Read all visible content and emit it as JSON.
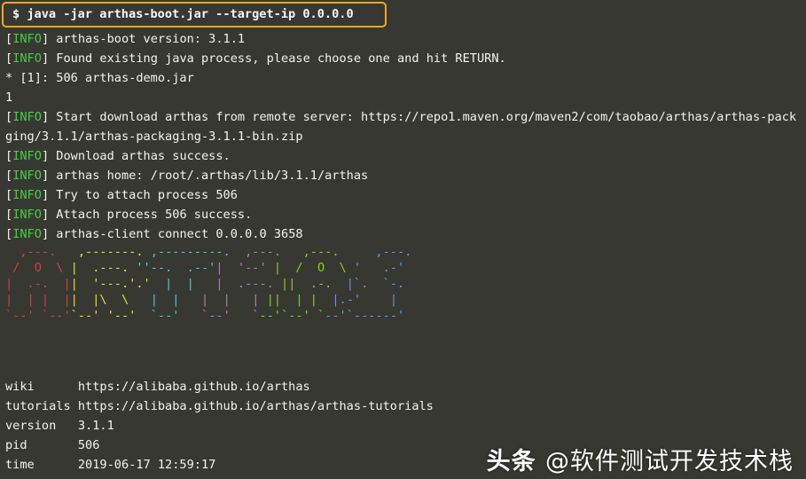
{
  "terminal": {
    "background_color": "#383833",
    "foreground_color": "#f2f2f0",
    "prompt_box_color": "#f5a71b",
    "info_tag_color": "#41d13c"
  },
  "command": {
    "prompt": "$",
    "text": "$ java -jar arthas-boot.jar --target-ip 0.0.0.0"
  },
  "log_lines": [
    {
      "tag": "[INFO]",
      "text": " arthas-boot version: 3.1.1"
    },
    {
      "tag": "[INFO]",
      "text": " Found existing java process, please choose one and hit RETURN."
    }
  ],
  "process_line": "* [1]: 506 arthas-demo.jar",
  "selection_input": "1",
  "download_lines": [
    {
      "tag": "[INFO]",
      "text": " Start download arthas from remote server: https://repo1.maven.org/maven2/com/taobao/arthas/arthas-pack"
    },
    {
      "tag": "",
      "text": "ging/3.1.1/arthas-packaging-3.1.1-bin.zip"
    },
    {
      "tag": "[INFO]",
      "text": " Download arthas success."
    },
    {
      "tag": "[INFO]",
      "text": " arthas home: /root/.arthas/lib/3.1.1/arthas"
    },
    {
      "tag": "[INFO]",
      "text": " Try to attach process 506"
    },
    {
      "tag": "[INFO]",
      "text": " Attach process 506 success."
    },
    {
      "tag": "[INFO]",
      "text": " arthas-client connect 0.0.0.0 3658"
    }
  ],
  "banner": {
    "description": "ARTHAS ascii-art logo in rainbow colors",
    "colors": [
      "#d43f3a",
      "#e8e030",
      "#3ad1d1",
      "#b07cb8",
      "#7ed321",
      "#5b9bd5"
    ],
    "rows": [
      [
        {
          "color": "c-red",
          "text": "  ,---.  "
        },
        {
          "color": "c-yellow",
          "text": " ,-------. "
        },
        {
          "color": "c-cyan",
          "text": ",---------. "
        },
        {
          "color": "c-purple",
          "text": " ,---.  "
        },
        {
          "color": "c-green",
          "text": " ,---.    "
        },
        {
          "color": "c-blue",
          "text": " ,---. "
        }
      ],
      [
        {
          "color": "c-red",
          "text": " /  O  \\ "
        },
        {
          "color": "c-yellow",
          "text": "|  .---. "
        },
        {
          "color": "c-cyan",
          "text": "''--.  .--'"
        },
        {
          "color": "c-purple",
          "text": "|  '--' "
        },
        {
          "color": "c-green",
          "text": "|  /  O  \\ "
        },
        {
          "color": "c-blue",
          "text": "'   .-'"
        }
      ],
      [
        {
          "color": "c-red",
          "text": "|  .-.  |"
        },
        {
          "color": "c-yellow",
          "text": "|  '---.'.'"
        },
        {
          "color": "c-cyan",
          "text": "  |  |   "
        },
        {
          "color": "c-purple",
          "text": "|  .---. "
        },
        {
          "color": "c-green",
          "text": "||  .-.  "
        },
        {
          "color": "c-blue",
          "text": "|`.  `-. "
        }
      ],
      [
        {
          "color": "c-red",
          "text": "|  | |  |"
        },
        {
          "color": "c-yellow",
          "text": "|  |\\  \\ "
        },
        {
          "color": "c-cyan",
          "text": "  |  |   "
        },
        {
          "color": "c-purple",
          "text": "|  |   | "
        },
        {
          "color": "c-green",
          "text": "||  | |  "
        },
        {
          "color": "c-blue",
          "text": "|.-'    |"
        }
      ],
      [
        {
          "color": "c-red",
          "text": "`--' `--'"
        },
        {
          "color": "c-yellow",
          "text": "`--' '--'"
        },
        {
          "color": "c-cyan",
          "text": "  `--'   "
        },
        {
          "color": "c-purple",
          "text": "`--'   `"
        },
        {
          "color": "c-green",
          "text": "--'`--' `"
        },
        {
          "color": "c-blue",
          "text": "--'`------'"
        }
      ]
    ]
  },
  "info_table": [
    {
      "key": "wiki",
      "value": "https://alibaba.github.io/arthas"
    },
    {
      "key": "tutorials",
      "value": "https://alibaba.github.io/arthas/arthas-tutorials"
    },
    {
      "key": "version",
      "value": "3.1.1"
    },
    {
      "key": "pid",
      "value": "506"
    },
    {
      "key": "time",
      "value": "2019-06-17 12:59:17"
    }
  ],
  "watermark": {
    "bold_part": "头条 ",
    "rest_part": "@软件测试开发技术栈"
  }
}
